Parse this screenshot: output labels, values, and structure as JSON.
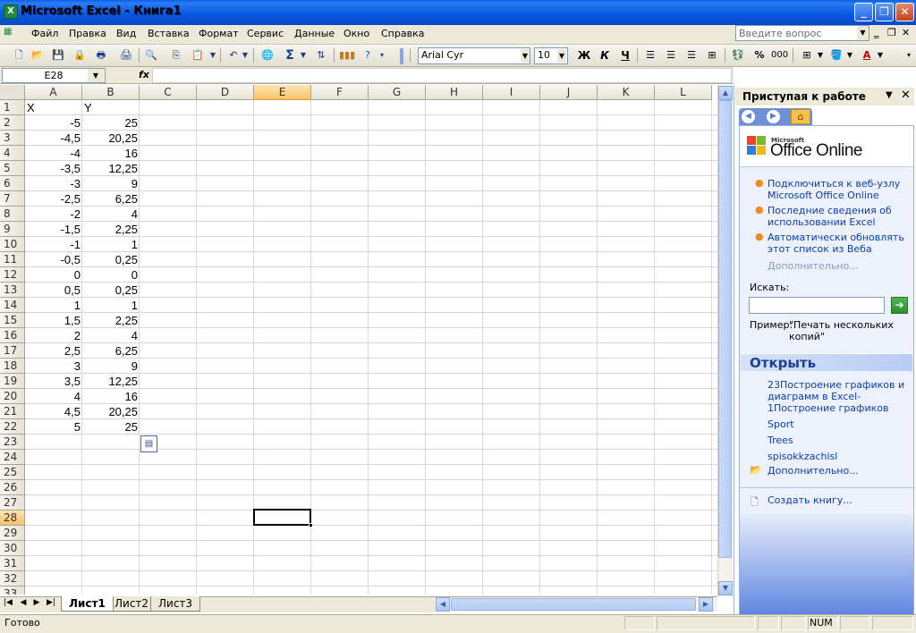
{
  "window": {
    "title": "Microsoft Excel - Книга1",
    "app_icon": "excel-icon"
  },
  "menu": [
    "Файл",
    "Правка",
    "Вид",
    "Вставка",
    "Формат",
    "Сервис",
    "Данные",
    "Окно",
    "Справка"
  ],
  "help_box": {
    "placeholder": "Введите вопрос"
  },
  "toolbar": {
    "font": "Arial Cyr",
    "font_size": "10",
    "bold": "Ж",
    "italic": "К",
    "underline": "Ч",
    "sum": "Σ",
    "percent": "%",
    "thousands": "000"
  },
  "formula_bar": {
    "cell_ref": "E28",
    "fx": "fx",
    "value": ""
  },
  "grid": {
    "columns": [
      "A",
      "B",
      "C",
      "D",
      "E",
      "F",
      "G",
      "H",
      "I",
      "J",
      "K",
      "L"
    ],
    "selected_column": "E",
    "rows": [
      "1",
      "2",
      "3",
      "4",
      "5",
      "6",
      "7",
      "8",
      "9",
      "10",
      "11",
      "12",
      "13",
      "14",
      "15",
      "16",
      "17",
      "18",
      "19",
      "20",
      "21",
      "22",
      "23",
      "24",
      "25",
      "26",
      "27",
      "28",
      "29",
      "30",
      "31",
      "32",
      "33"
    ],
    "selected_row": "28",
    "header": {
      "A": "X",
      "B": "Y"
    },
    "x_values": [
      "-5",
      "-4,5",
      "-4",
      "-3,5",
      "-3",
      "-2,5",
      "-2",
      "-1,5",
      "-1",
      "-0,5",
      "0",
      "0,5",
      "1",
      "1,5",
      "2",
      "2,5",
      "3",
      "3,5",
      "4",
      "4,5",
      "5"
    ],
    "y_values": [
      "25",
      "20,25",
      "16",
      "12,25",
      "9",
      "6,25",
      "4",
      "2,25",
      "1",
      "0,25",
      "0",
      "0,25",
      "1",
      "2,25",
      "4",
      "6,25",
      "9",
      "12,25",
      "16",
      "20,25",
      "25"
    ]
  },
  "sheets": {
    "tabs": [
      "Лист1",
      "Лист2",
      "Лист3"
    ],
    "active": "Лист1"
  },
  "status": {
    "text": "Готово",
    "num": "NUM"
  },
  "taskpane": {
    "title": "Приступая к работе",
    "logo_small": "Microsoft",
    "logo": "Office Online",
    "links": [
      "Подключиться к веб-узлу Microsoft Office Online",
      "Последние сведения об использовании Excel",
      "Автоматически обновлять этот список из Веба"
    ],
    "more": "Дополнительно...",
    "search_label": "Искать:",
    "example_label": "Пример:",
    "example_text": "\"Печать нескольких копий\"",
    "open_title": "Открыть",
    "files": [
      "23Построение графиков и диаграмм в Excel-1Построение графиков",
      "Sport",
      "Trees",
      "spisokkzachisl"
    ],
    "open_more": "Дополнительно...",
    "new_book": "Создать книгу..."
  }
}
